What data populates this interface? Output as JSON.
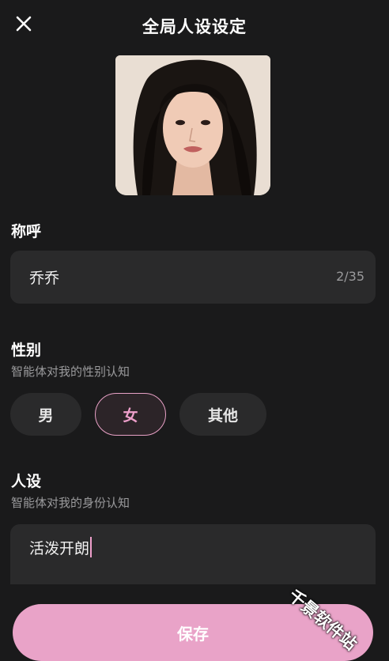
{
  "header": {
    "title": "全局人设设定",
    "close_icon": "close-icon"
  },
  "avatar": {
    "description_icon": "avatar-photo"
  },
  "nickname": {
    "label": "称呼",
    "value": "乔乔",
    "counter": "2/35"
  },
  "gender": {
    "label": "性别",
    "subtitle": "智能体对我的性别认知",
    "options": [
      "男",
      "女",
      "其他"
    ],
    "selected": "女"
  },
  "persona": {
    "label": "人设",
    "subtitle": "智能体对我的身份认知",
    "value": "活泼开朗"
  },
  "footer": {
    "save_label": "保存"
  },
  "watermark": {
    "text": "千景软件站"
  },
  "colors": {
    "background": "#1a1a1b",
    "field": "#2a2a2b",
    "accent": "#e9a3c8",
    "muted_text": "#9a9a9c"
  }
}
